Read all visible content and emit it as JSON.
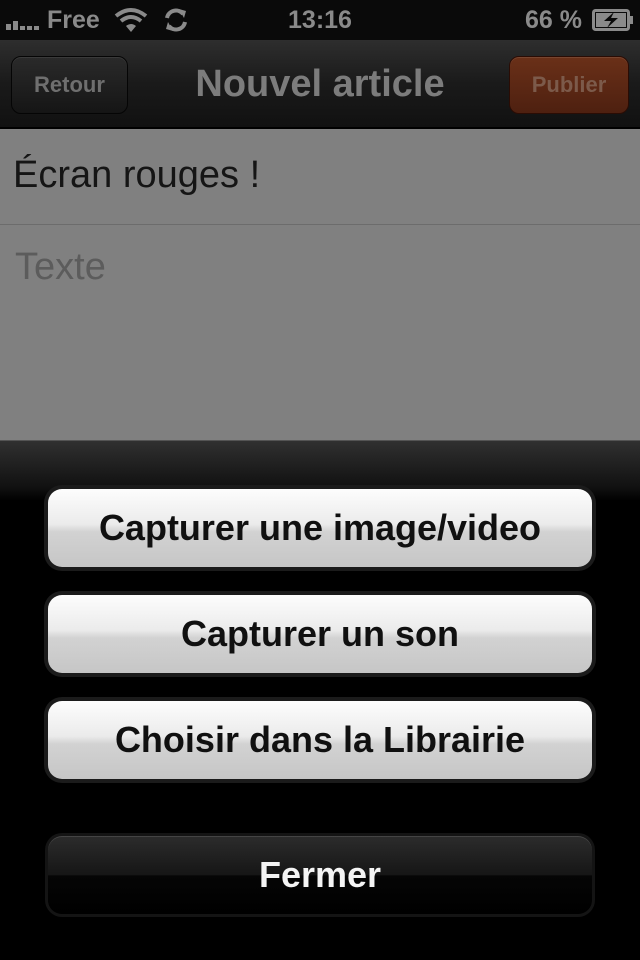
{
  "status_bar": {
    "carrier": "Free",
    "time": "13:16",
    "battery_percent": "66 %",
    "icons": [
      "signal-icon",
      "wifi-icon",
      "sync-icon",
      "battery-charging-icon"
    ],
    "battery_level": 0.66
  },
  "nav_bar": {
    "title": "Nouvel article",
    "back_label": "Retour",
    "publish_label": "Publier"
  },
  "editor": {
    "title_value": "Écran rouges !",
    "body_placeholder": "Texte"
  },
  "action_sheet": {
    "buttons": [
      {
        "label": "Capturer une image/video"
      },
      {
        "label": "Capturer un son"
      },
      {
        "label": "Choisir dans la Librairie"
      }
    ],
    "close_label": "Fermer"
  },
  "colors": {
    "publish_accent": "#5a2614",
    "editor_background": "#808080",
    "sheet_background": "#000000"
  }
}
